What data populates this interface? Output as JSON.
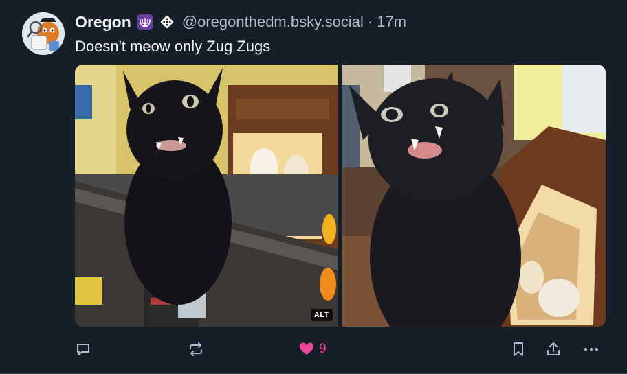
{
  "post": {
    "author": {
      "display_name": "Oregon",
      "handle": "@oregonthedm.bsky.social",
      "badges": [
        "menorah-icon",
        "dice-icon"
      ]
    },
    "separator": "·",
    "timestamp": "17m",
    "text": "Doesn't meow only Zug Zugs",
    "images": [
      {
        "subject": "black cat on shelf with owl figurines",
        "alt_badge": "ALT"
      },
      {
        "subject": "black cat showing fangs next to lit display case",
        "alt_badge": ""
      }
    ],
    "actions": {
      "reply_icon": "reply-icon",
      "repost_icon": "repost-icon",
      "like_icon": "heart-icon",
      "like_count": "9",
      "bookmark_icon": "bookmark-icon",
      "share_icon": "share-icon",
      "more_icon": "more-icon"
    },
    "colors": {
      "background": "#161e27",
      "text": "#f1f3f5",
      "secondary_text": "#aebbc9",
      "like": "#ec4899",
      "icon": "#aebbc9"
    }
  }
}
